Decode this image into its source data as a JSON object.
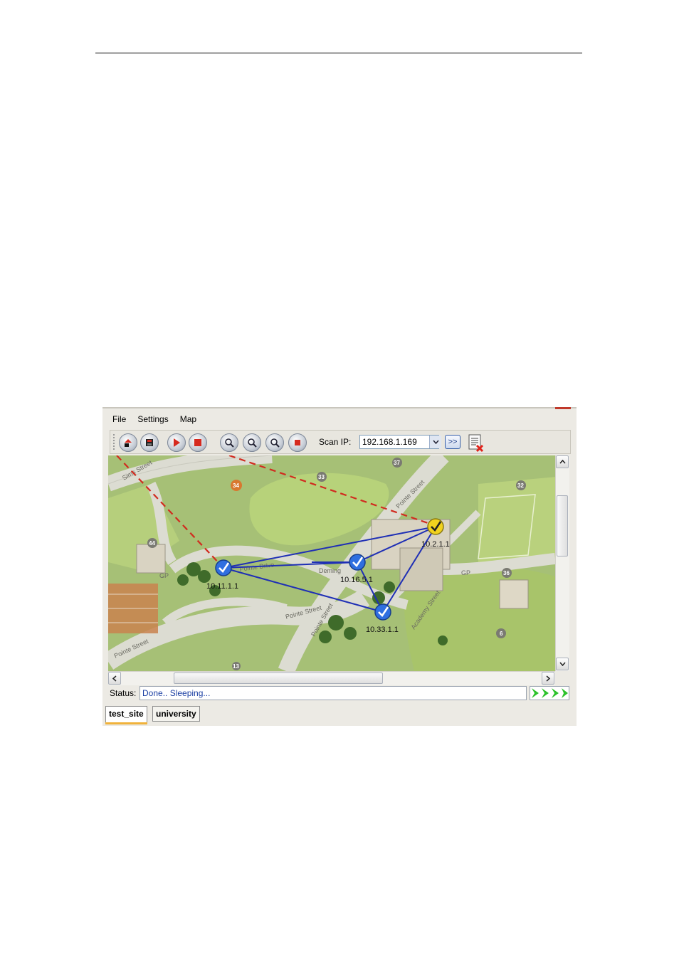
{
  "menu": [
    "File",
    "Settings",
    "Map"
  ],
  "toolbar": {
    "scan_label": "Scan IP:",
    "scan_value": "192.168.1.169",
    "go_label": ">>"
  },
  "map": {
    "nodes": [
      {
        "label": "10.2.1.1",
        "state": "warning",
        "color": "#f2d21e"
      },
      {
        "label": "10.11.1.1",
        "state": "ok",
        "color": "#2f6fe0"
      },
      {
        "label": "10.16.5.1",
        "state": "ok",
        "color": "#2f6fe0"
      },
      {
        "label": "10.33.1.1",
        "state": "ok",
        "color": "#2f6fe0"
      }
    ],
    "streets": [
      "Sims Street",
      "Pointe Drive",
      "Deming",
      "Pointe Street",
      "Academy Street",
      "Pointe Street",
      "Pointe Street",
      "Pointe Street"
    ],
    "buildings": [
      "33",
      "37",
      "34",
      "32",
      "44",
      "36",
      "6",
      "13"
    ],
    "lot_labels": [
      "GP",
      "GP"
    ],
    "link_color": "#1f2fb5",
    "inactive_link_color": "#d12b1f"
  },
  "status": {
    "label": "Status:",
    "text": "Done.. Sleeping..."
  },
  "tabs": [
    {
      "label": "test_site",
      "active": true
    },
    {
      "label": "university",
      "active": false
    }
  ]
}
